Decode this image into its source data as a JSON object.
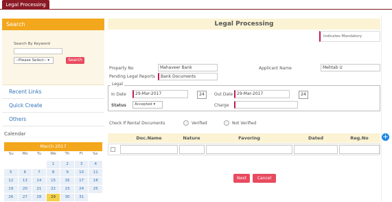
{
  "tab": {
    "label": "Legal Processing"
  },
  "sidebar": {
    "search_header": "Search",
    "search_label": "Search By Keyword",
    "select_value": "--Please Select--",
    "search_button": "Search",
    "items": [
      {
        "label": "Recent Links"
      },
      {
        "label": "Quick Create"
      },
      {
        "label": "Others"
      }
    ],
    "calendar_title": "Calendar",
    "calendar": {
      "month": "March 2017",
      "days": [
        "Su",
        "Mo",
        "Tu",
        "We",
        "Th",
        "Fr",
        "Sa"
      ],
      "cells": [
        "",
        "",
        "",
        "1",
        "2",
        "3",
        "4",
        "5",
        "6",
        "7",
        "8",
        "9",
        "10",
        "11",
        "12",
        "13",
        "14",
        "15",
        "16",
        "17",
        "18",
        "19",
        "20",
        "21",
        "22",
        "23",
        "24",
        "25",
        "26",
        "27",
        "28",
        "29",
        "30",
        "31",
        ""
      ],
      "today": "29"
    }
  },
  "main": {
    "title": "Legal Processing",
    "mandatory": "Indicates Mandatory",
    "property_no_label": "Property No",
    "property_no_value": "Mahaveer Bank",
    "applicant_label": "Applicant Name",
    "applicant_value": "Mehtab U",
    "pending_label": "Pending Legal Reports",
    "pending_value": "Bank Documents",
    "legal_legend": "Legal",
    "in_date_label": "In Date",
    "in_date_value": "29-Mar-2017",
    "out_date_label": "Out Date",
    "out_date_value": "29-Mar-2017",
    "status_label": "Status",
    "status_value": "Accepted",
    "charge_label": "Charge",
    "check_text": "Check If Rental Documents",
    "radio1": "Verified",
    "radio2": "Not Verified",
    "table_headers": [
      "Doc.Name",
      "Nature",
      "Favoring",
      "Dated",
      "Reg.No"
    ],
    "next_button": "Next",
    "cancel_button": "Cancel"
  }
}
